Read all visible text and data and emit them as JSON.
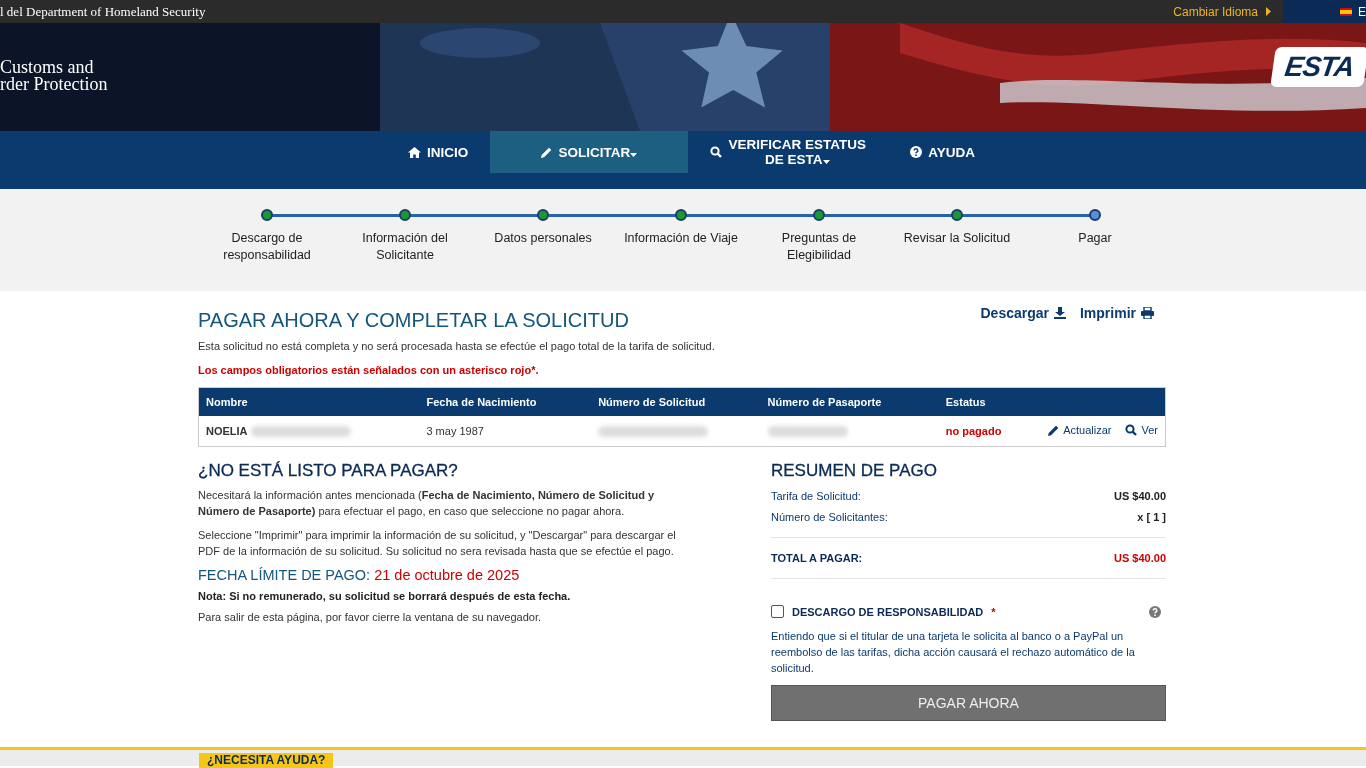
{
  "top_bar": {
    "agency": "l del Department of Homeland Security",
    "language_link": "Cambiar Idioma",
    "language_code": "E"
  },
  "banner": {
    "org_lines": [
      "Customs and",
      "rder Protection"
    ],
    "logo": "ESTA"
  },
  "nav": [
    {
      "label": "INICIO",
      "dropdown": false,
      "selected": false
    },
    {
      "label": "SOLICITAR",
      "dropdown": true,
      "selected": true
    },
    {
      "label": "VERIFICAR ESTATUS DE ESTA",
      "dropdown": true,
      "selected": false
    },
    {
      "label": "AYUDA",
      "dropdown": false,
      "selected": false
    }
  ],
  "steps": [
    {
      "label": "Descargo de responsabilidad",
      "completed": true
    },
    {
      "label": "Información del Solicitante",
      "completed": true
    },
    {
      "label": "Datos personales",
      "completed": true
    },
    {
      "label": "Información de Viaje",
      "completed": true
    },
    {
      "label": "Preguntas de Elegibilidad",
      "completed": true
    },
    {
      "label": "Revisar la Solicitud",
      "completed": true
    },
    {
      "label": "Pagar",
      "completed": false
    }
  ],
  "page": {
    "title": "PAGAR AHORA Y COMPLETAR LA SOLICITUD",
    "download": "Descargar",
    "print": "Imprimir",
    "intro": "Esta solicitud no está completa y no será procesada hasta se efectúe el pago total de la tarifa de solicitud.",
    "required_note": "Los campos obligatorios están señalados con un asterisco rojo*."
  },
  "table": {
    "columns": [
      "Nombre",
      "Fecha de Nacimiento",
      "Número de Solicitud",
      "Número de Pasaporte",
      "Estatus"
    ],
    "rows": [
      {
        "name": "NOELIA",
        "birth_date": "3 may 1987",
        "status": "no pagado",
        "update": "Actualizar",
        "view": "Ver"
      }
    ]
  },
  "not_ready": {
    "title": "¿NO ESTÁ LISTO PARA PAGAR?",
    "paragraphs": [
      "Necesitará la información antes mencionada (**Fecha de Nacimiento, Número de Solicitud y Número de Pasaporte)** para efectuar el pago, en caso que seleccione no pagar ahora.",
      "Seleccione \"Imprimir\" para imprimir la información de su solicitud, y \"Descargar\" para descargar el PDF de la información de su solicitud. Su solicitud no sera revisada hasta que se efectúe el pago."
    ],
    "deadline_label": "FECHA LÍMITE DE PAGO:",
    "deadline_date": "21 de octubre de 2025",
    "note": "Nota: Si no remunerado, su solicitud se borrará después de esta fecha.",
    "exit": "Para salir de esta página, por favor cierre la ventana de su navegador."
  },
  "summary": {
    "title": "RESUMEN DE PAGO",
    "lines": [
      {
        "label": "Tarifa de Solicitud:",
        "value": "US $40.00"
      },
      {
        "label": "Número de Solicitantes:",
        "value": "x [ 1 ]"
      }
    ],
    "total_label": "TOTAL A PAGAR:",
    "total_value": "US $40.00",
    "disclaimer": {
      "label": "DESCARGO DE RESPONSABILIDAD",
      "required": "*",
      "checked": false,
      "text": "Entiendo que si el titular de una tarjeta le solicita al banco o a PayPal un reembolso de las tarifas, dicha acción causará el rechazo automático de la solicitud."
    },
    "pay_button": "PAGAR AHORA"
  },
  "footer": {
    "help_tab": "¿NECESITA AYUDA?"
  }
}
